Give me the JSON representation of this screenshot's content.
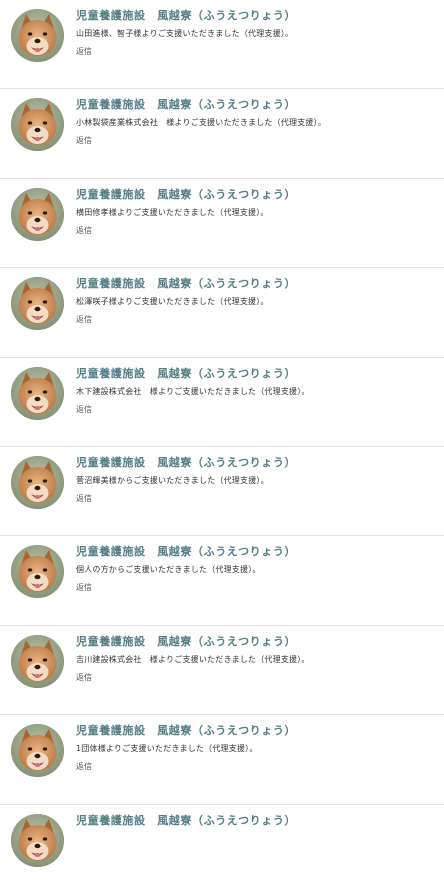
{
  "feed": {
    "items": [
      {
        "title": "児童養護施設　風越寮（ふうえつりょう）",
        "text": "山田進様、智子様よりご支援いただきました（代理支援）。",
        "reply": "返信",
        "avatar_icon": "dog-avatar"
      },
      {
        "title": "児童養護施設　風越寮（ふうえつりょう）",
        "text": "小林製袋産業株式会社　様よりご支援いただきました（代理支援）。",
        "reply": "返信",
        "avatar_icon": "dog-avatar"
      },
      {
        "title": "児童養護施設　風越寮（ふうえつりょう）",
        "text": "横田修孝様よりご支援いただきました（代理支援）。",
        "reply": "返信",
        "avatar_icon": "dog-avatar"
      },
      {
        "title": "児童養護施設　風越寮（ふうえつりょう）",
        "text": "松澤咲子様よりご支援いただきました（代理支援）。",
        "reply": "返信",
        "avatar_icon": "dog-avatar"
      },
      {
        "title": "児童養護施設　風越寮（ふうえつりょう）",
        "text": "木下建設株式会社　様よりご支援いただきました（代理支援）。",
        "reply": "返信",
        "avatar_icon": "dog-avatar"
      },
      {
        "title": "児童養護施設　風越寮（ふうえつりょう）",
        "text": "菅沼輝美様からご支援いただきました（代理支援）。",
        "reply": "返信",
        "avatar_icon": "dog-avatar"
      },
      {
        "title": "児童養護施設　風越寮（ふうえつりょう）",
        "text": "個人の方からご支援いただきました（代理支援）。",
        "reply": "返信",
        "avatar_icon": "dog-avatar"
      },
      {
        "title": "児童養護施設　風越寮（ふうえつりょう）",
        "text": "吉川建設株式会社　様よりご支援いただきました（代理支援）。",
        "reply": "返信",
        "avatar_icon": "dog-avatar"
      },
      {
        "title": "児童養護施設　風越寮（ふうえつりょう）",
        "text": "1団体様よりご支援いただきました（代理支援）。",
        "reply": "返信",
        "avatar_icon": "dog-avatar"
      },
      {
        "title": "児童養護施設　風越寮（ふうえつりょう）",
        "text": "",
        "reply": "",
        "avatar_icon": "dog-avatar"
      }
    ]
  },
  "colors": {
    "title": "#547e87",
    "text": "#333333",
    "divider": "#e2e2e2"
  }
}
